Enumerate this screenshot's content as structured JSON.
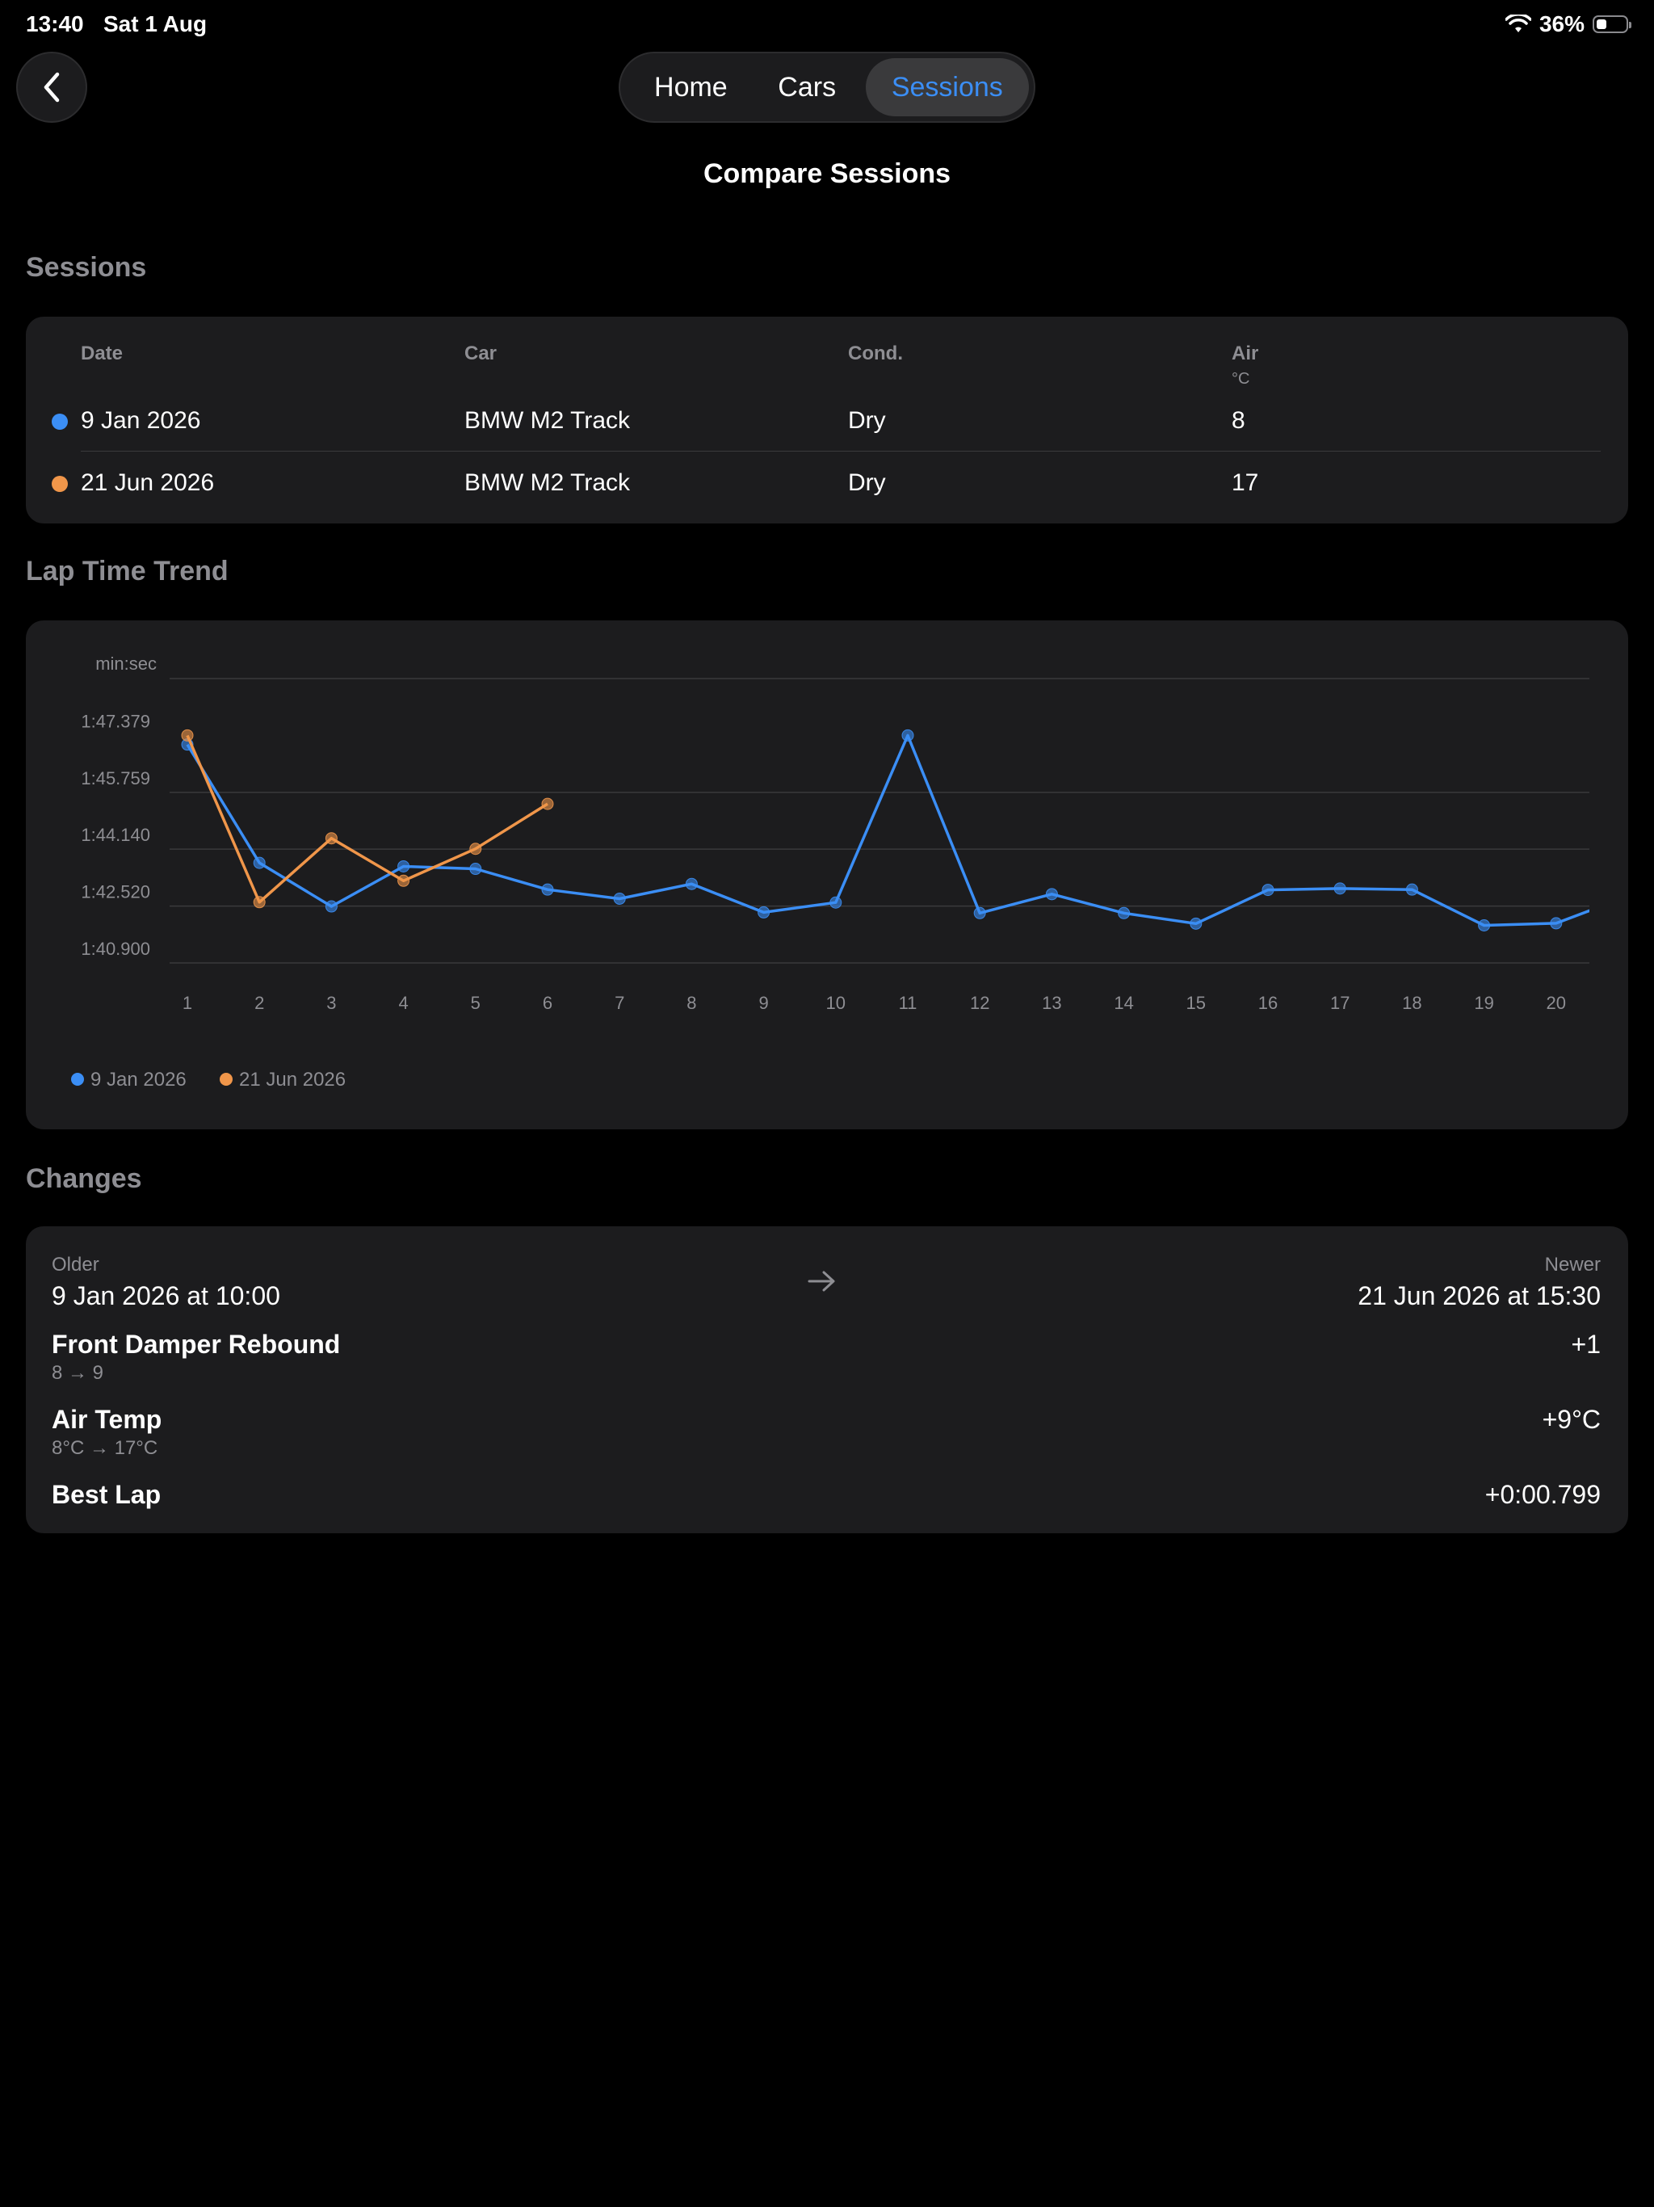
{
  "status": {
    "time": "13:40",
    "date": "Sat 1 Aug",
    "battery": "36%",
    "battery_level": 0.36
  },
  "nav": {
    "tabs": [
      "Home",
      "Cars",
      "Sessions"
    ],
    "selected": "Sessions"
  },
  "page": {
    "title": "Compare Sessions"
  },
  "sessions": {
    "header": "Sessions",
    "columns": {
      "date": "Date",
      "car": "Car",
      "cond": "Cond.",
      "air": "Air",
      "air_unit": "°C"
    },
    "rows": [
      {
        "date": "9 Jan 2026",
        "car": "BMW M2 Track",
        "cond": "Dry",
        "air": "8",
        "color": "#3b8ef5"
      },
      {
        "date": "21 Jun 2026",
        "car": "BMW M2 Track",
        "cond": "Dry",
        "air": "17",
        "color": "#f0964a"
      }
    ]
  },
  "trend": {
    "header": "Lap Time Trend"
  },
  "chart_data": {
    "type": "line",
    "y_unit_label": "min:sec",
    "y_ticks": [
      "1:47.379",
      "1:45.759",
      "1:44.140",
      "1:42.520",
      "1:40.900"
    ],
    "y_tick_seconds": [
      107.379,
      105.759,
      104.14,
      102.52,
      100.9
    ],
    "ylim": [
      100.9,
      107.379
    ],
    "ylim_seconds_top": 108.999,
    "x": [
      1,
      2,
      3,
      4,
      5,
      6,
      7,
      8,
      9,
      10,
      11,
      12,
      13,
      14,
      15,
      16,
      17,
      18,
      19,
      20
    ],
    "series": [
      {
        "name": "9 Jan 2026",
        "color": "#3b8ef5",
        "values": [
          107.12,
          103.75,
          102.51,
          103.65,
          103.58,
          102.99,
          102.73,
          103.15,
          102.34,
          102.62,
          107.38,
          102.32,
          102.86,
          102.32,
          102.02,
          102.98,
          103.02,
          102.99,
          101.97,
          102.03,
          102.8
        ]
      },
      {
        "name": "21 Jun 2026",
        "color": "#f0964a",
        "values": [
          107.38,
          102.63,
          104.45,
          103.24,
          104.15,
          105.43
        ]
      }
    ],
    "legend": [
      "9 Jan 2026",
      "21 Jun 2026"
    ],
    "legend_position": "bottom-left",
    "grid": true
  },
  "changes": {
    "header": "Changes",
    "older_label": "Older",
    "older_date": "9 Jan 2026 at 10:00",
    "newer_label": "Newer",
    "newer_date": "21 Jun 2026 at 15:30",
    "items": [
      {
        "name": "Front Damper Rebound",
        "detail": "8 → 9",
        "delta": "+1"
      },
      {
        "name": "Air Temp",
        "detail": "8°C → 17°C",
        "delta": "+9°C"
      },
      {
        "name": "Best Lap",
        "detail": "",
        "delta": "+0:00.799"
      }
    ]
  }
}
